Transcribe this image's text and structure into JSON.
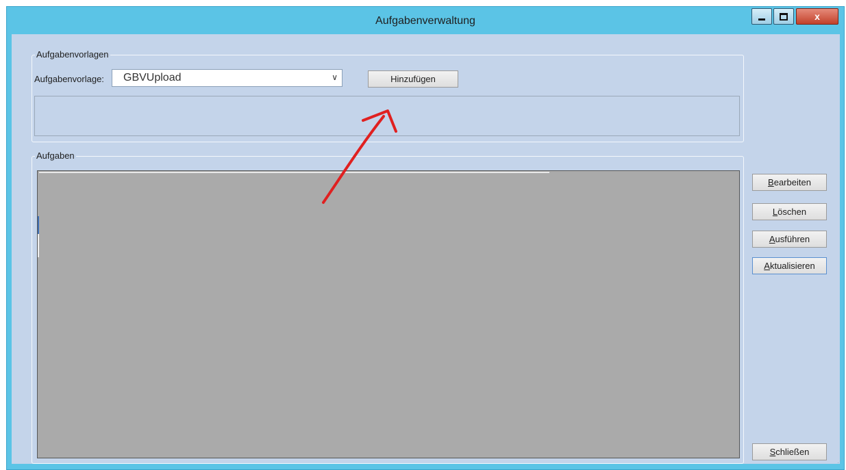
{
  "window": {
    "title": "Aufgabenverwaltung",
    "close_label": "x"
  },
  "templates": {
    "group_label": "Aufgabenvorlagen",
    "field_label": "Aufgabenvorlage:",
    "selected_value": "GBVUpload",
    "add_button": "Hinzufügen"
  },
  "tasks": {
    "group_label": "Aufgaben"
  },
  "side_buttons": {
    "edit": {
      "mnemonic": "B",
      "rest": "earbeiten"
    },
    "delete": {
      "mnemonic": "L",
      "rest": "öschen"
    },
    "run": {
      "mnemonic": "A",
      "rest": "usführen"
    },
    "refresh": {
      "mnemonic": "A",
      "rest": "ktualisieren"
    },
    "close": {
      "mnemonic": "S",
      "rest": "chließen"
    }
  },
  "colors": {
    "titlebar": "#5bc4e6",
    "client": "#c4d4ea",
    "grid": "#aaaaaa",
    "annotation_arrow": "#e02020"
  }
}
